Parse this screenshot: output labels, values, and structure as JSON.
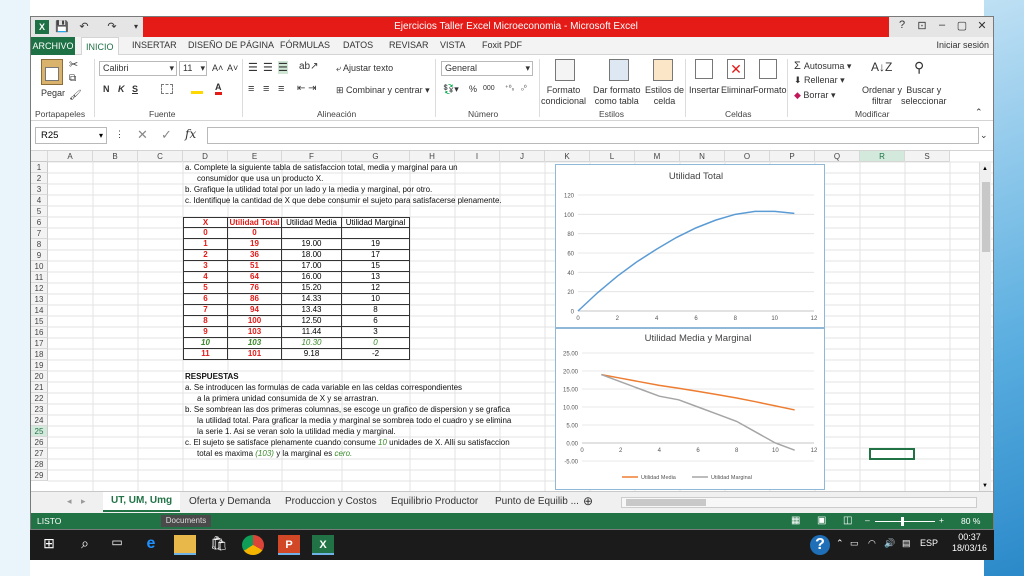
{
  "window": {
    "title": "Ejercicios Taller Excel Microeconomia -  Microsoft Excel",
    "help": "?",
    "restore": "⊡",
    "minimize": "–",
    "maximize": "▢",
    "close": "✕"
  },
  "qat": {
    "save": "💾",
    "undo": "↶",
    "redo": "↷"
  },
  "tabs": {
    "file": "ARCHIVO",
    "home": "INICIO",
    "insert": "INSERTAR",
    "layout": "DISEÑO DE PÁGINA",
    "formulas": "FÓRMULAS",
    "data": "DATOS",
    "review": "REVISAR",
    "view": "VISTA",
    "foxit": "Foxit PDF",
    "signin": "Iniciar sesión"
  },
  "ribbon": {
    "paste": "Pegar",
    "clipboard": "Portapapeles",
    "font_name": "Calibri",
    "font_size": "11",
    "grow": "A˄",
    "shrink": "A˅",
    "bold": "N",
    "italic": "K",
    "underline": "S",
    "font_group": "Fuente",
    "wrap": "Ajustar texto",
    "merge": "Combinar y centrar",
    "align_group": "Alineación",
    "number_format": "General",
    "percent": "%",
    "thousands": "000",
    "number_group": "Número",
    "cond_format": "Formato\ncondicional",
    "as_table": "Dar formato\ncomo tabla",
    "cell_styles": "Estilos de\ncelda",
    "styles_group": "Estilos",
    "insert": "Insertar",
    "delete": "Eliminar",
    "format": "Formato",
    "cells_group": "Celdas",
    "autosum": "Autosuma",
    "fill": "Rellenar",
    "clear": "Borrar",
    "sort": "Ordenar y\nfiltrar",
    "find": "Buscar y\nseleccionar",
    "modify_group": "Modificar"
  },
  "formula_bar": {
    "name_box": "R25",
    "fx": "fx",
    "cancel": "✕",
    "enter": "✓"
  },
  "columns": [
    "A",
    "B",
    "C",
    "D",
    "E",
    "F",
    "G",
    "H",
    "I",
    "J",
    "K",
    "L",
    "M",
    "N",
    "O",
    "P",
    "Q",
    "R",
    "S"
  ],
  "rows": [
    "1",
    "2",
    "3",
    "4",
    "5",
    "6",
    "7",
    "8",
    "9",
    "10",
    "11",
    "12",
    "13",
    "14",
    "15",
    "16",
    "17",
    "18",
    "19",
    "20",
    "21",
    "22",
    "23",
    "24",
    "25",
    "26",
    "27",
    "28",
    "29"
  ],
  "text": {
    "r1": "a. Complete la siguiente tabla de satisfaccion total, media y marginal para un",
    "r2": "consumidor que usa un producto X.",
    "r3": "b. Grafique la utilidad total por un lado y la media y marginal, por otro.",
    "r4": "c. Identifique la cantidad de X que debe consumir el sujeto para satisfacerse plenamente.",
    "r20": "RESPUESTAS",
    "r21": "a. Se introducen las formulas de cada variable en las celdas correspondientes",
    "r22": "a la primera unidad consumida de X y se arrastran.",
    "r23": "b. Se sombrean las dos primeras columnas, se escoge un grafico de dispersion y se grafica",
    "r24": "la utilidad total. Para graficar la media y marginal se sombrea todo el cuadro y se elimina",
    "r25": "la serie 1. Asi se veran solo la utilidad media y marginal.",
    "r26a": "c. El sujeto se satisface plenamente cuando consume",
    "r26b": "10",
    "r26c": "unidades de X. Alli su satisfaccion",
    "r27a": "total es maxima",
    "r27b": "(103)",
    "r27c": "y la marginal es",
    "r27d": "cero."
  },
  "table": {
    "headers": [
      "X",
      "Utilidad Total",
      "Utilidad Media",
      "Utilidad Marginal"
    ],
    "rows": [
      [
        "0",
        "0",
        "",
        ""
      ],
      [
        "1",
        "19",
        "19.00",
        "19"
      ],
      [
        "2",
        "36",
        "18.00",
        "17"
      ],
      [
        "3",
        "51",
        "17.00",
        "15"
      ],
      [
        "4",
        "64",
        "16.00",
        "13"
      ],
      [
        "5",
        "76",
        "15.20",
        "12"
      ],
      [
        "6",
        "86",
        "14.33",
        "10"
      ],
      [
        "7",
        "94",
        "13.43",
        "8"
      ],
      [
        "8",
        "100",
        "12.50",
        "6"
      ],
      [
        "9",
        "103",
        "11.44",
        "3"
      ],
      [
        "10",
        "103",
        "10.30",
        "0"
      ],
      [
        "11",
        "101",
        "9.18",
        "-2"
      ]
    ],
    "red": "#e41b17",
    "green": "#3a8a2a"
  },
  "chart_data": [
    {
      "type": "scatter",
      "title": "Utilidad Total",
      "x": [
        0,
        1,
        2,
        3,
        4,
        5,
        6,
        7,
        8,
        9,
        10,
        11
      ],
      "series": [
        {
          "values": [
            0,
            19,
            36,
            51,
            64,
            76,
            86,
            94,
            100,
            103,
            103,
            101
          ],
          "color": "#5b9bd5"
        }
      ],
      "xlim": [
        0,
        12
      ],
      "ylim": [
        0,
        120
      ],
      "xticks": [
        "0",
        "2",
        "4",
        "6",
        "8",
        "10",
        "12"
      ],
      "yticks": [
        "0",
        "20",
        "40",
        "60",
        "80",
        "100",
        "120"
      ]
    },
    {
      "type": "line",
      "title": "Utilidad Media y Marginal",
      "x": [
        1,
        2,
        3,
        4,
        5,
        6,
        7,
        8,
        9,
        10,
        11
      ],
      "series": [
        {
          "name": "Utilidad Media",
          "values": [
            19.0,
            18.0,
            17.0,
            16.0,
            15.2,
            14.33,
            13.43,
            12.5,
            11.44,
            10.3,
            9.18
          ],
          "color": "#ed7d31"
        },
        {
          "name": "Utilidad Marginal",
          "values": [
            19,
            17,
            15,
            13,
            12,
            10,
            8,
            6,
            3,
            0,
            -2
          ],
          "color": "#a5a5a5"
        }
      ],
      "xlim": [
        0,
        12
      ],
      "ylim": [
        -5,
        25
      ],
      "xticks": [
        "0",
        "2",
        "4",
        "6",
        "8",
        "10",
        "12"
      ],
      "yticks": [
        "-5.00",
        "0.00",
        "5.00",
        "10.00",
        "15.00",
        "20.00",
        "25.00"
      ]
    }
  ],
  "sheets": {
    "nav_prev": "◂",
    "nav_next": "▸",
    "s1": "UT, UM, Umg",
    "s2": "Oferta y Demanda",
    "s3": "Produccion y Costos",
    "s4": "Equilibrio Productor",
    "s5": "Punto de Equilib ...",
    "add": "⊕"
  },
  "status": {
    "ready": "LISTO",
    "zoom": "80 %",
    "minus": "–",
    "plus": "+"
  },
  "tooltip": "Documents",
  "taskbar": {
    "lang": "ESP",
    "time": "00:37",
    "date": "18/03/16"
  }
}
